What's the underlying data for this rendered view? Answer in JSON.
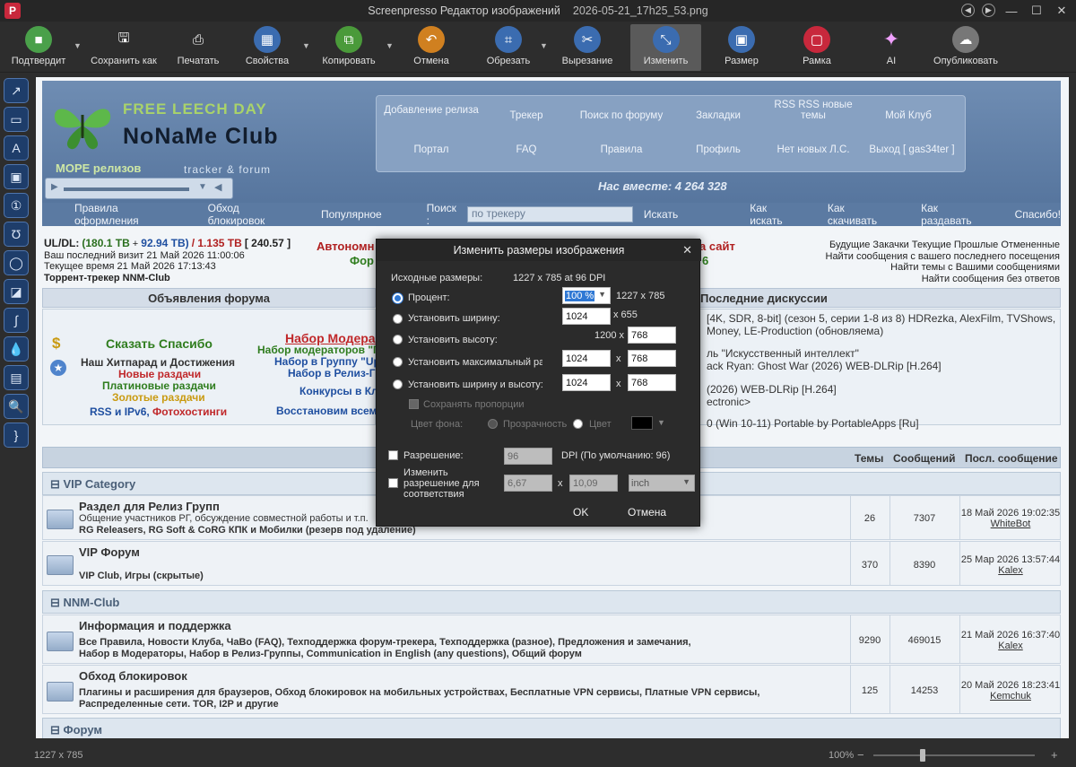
{
  "window": {
    "app_title": "Screenpresso Редактор изображений",
    "file_name": "2026-05-21_17h25_53.png"
  },
  "toolbar": [
    {
      "label": "Подтвердит",
      "icon": "save-check-icon",
      "color": "#4aa04a"
    },
    {
      "label": "Сохранить как",
      "icon": "floppy-icon",
      "color": ""
    },
    {
      "label": "Печатать",
      "icon": "printer-icon",
      "color": ""
    },
    {
      "label": "Свойства",
      "icon": "grid-icon",
      "color": "#3b6cb0"
    },
    {
      "label": "Копировать",
      "icon": "copy-icon",
      "color": "#4a9a3a"
    },
    {
      "label": "Отмена",
      "icon": "undo-icon",
      "color": "#d08020"
    },
    {
      "label": "Обрезать",
      "icon": "crop-icon",
      "color": "#3b6cb0"
    },
    {
      "label": "Вырезание",
      "icon": "cut-icon",
      "color": "#3b6cb0"
    },
    {
      "label": "Изменить",
      "icon": "resize-icon",
      "color": "#3b6cb0"
    },
    {
      "label": "Размер",
      "icon": "size-icon",
      "color": "#3b6cb0"
    },
    {
      "label": "Рамка",
      "icon": "frame-icon",
      "color": "#c8283c"
    },
    {
      "label": "AI",
      "icon": "ai-sparkle-icon",
      "color": ""
    },
    {
      "label": "Опубликовать",
      "icon": "cloud-upload-icon",
      "color": "#777"
    }
  ],
  "site": {
    "logo": {
      "line1": "FREE LEECH DAY",
      "line2": "NoNaMe Club",
      "line3": "МОРЕ релизов",
      "line4": "tracker & forum"
    },
    "nav_top": [
      "Добавление релиза",
      "Трекер",
      "Поиск по форуму",
      "Закладки",
      "RSS RSS новые темы",
      "Мой Клуб"
    ],
    "nav_bottom": [
      "Портал",
      "FAQ",
      "Правила",
      "Профиль",
      "Нет новых Л.С.",
      "Выход [ gas34ter ]"
    ],
    "together": "Нас вместе: 4 264 328",
    "subnav": [
      "Правила оформления",
      "Обход блокировок",
      "Популярное"
    ],
    "search_label": "Поиск :",
    "search_placeholder": "по трекеру",
    "search_button": "Искать",
    "subnav_right": [
      "Как искать",
      "Как скачивать",
      "Как раздавать",
      "Спасибо!"
    ],
    "stats": {
      "ul_dl_label": "UL/DL:",
      "ul": "(180.1 TB",
      "dl": "92.94 TB)",
      "ratio_part": "/ 1.135 TB",
      "bonus": "[ 240.57 ]",
      "last_visit": "Ваш последний визит 21 Май 2026 11:00:06",
      "now": "Текущее время 21 Май 2026 17:13:43",
      "tracker": "Торрент-трекер NNM-Club"
    },
    "promo_left": "Автономн",
    "promo_left2": "Фор",
    "promo_right": "а сайт",
    "promo_right2": "6",
    "right_links": [
      "Будущие Закачки Текущие Прошлые Отмененные",
      "Найти сообщения с вашего последнего посещения",
      "Найти темы с Вашими сообщениями",
      "Найти сообщения без ответов"
    ],
    "forum_ads_title": "Объявления форума",
    "ads_links": [
      "Сказать Спасибо",
      "Наш Хитпарад и Достижения",
      "Новые раздачи",
      "Платиновые раздачи",
      "Золотые раздачи",
      "RSS и IPv6,",
      "Фотохостинги"
    ],
    "moder_links": [
      "Набор Модерат",
      "Набор модераторов \"Г",
      "Набор в Группу \"Up",
      "Набор в Релиз-Гр",
      "Конкурсы в Кл",
      "Восстановим всем"
    ],
    "discussions_title": "Последние дискуссии",
    "discussions": [
      "[4K, SDR, 8-bit] (сезон 5, серии 1-8 из 8) HDRezka, AlexFilm, TVShows,",
      "Money, LE-Production (обновляема)",
      "ль \"Искусственный интеллект\"",
      "ack Ryan: Ghost War (2026) WEB-DLRip [H.264]",
      "(2026) WEB-DLRip [H.264]",
      "ectronic>",
      "0 (Win 10-11) Portable by PortableApps [Ru]"
    ],
    "table_headers": [
      "Темы",
      "Сообщений",
      "Посл. сообщение"
    ],
    "categories": [
      "VIP Category",
      "NNM-Club",
      "Форум"
    ],
    "forums": [
      {
        "title": "Раздел для Релиз Групп",
        "desc": "Общение участников РГ, обсуждение совместной работы и т.п.",
        "subs": "RG Releasers,  RG Soft & CoRG КПК и Мобилки (резерв под удаление)",
        "subs2": "",
        "topics": "26",
        "posts": "7307",
        "last_date": "18 Май 2026 19:02:35",
        "last_user": "WhiteBot"
      },
      {
        "title": "VIP Форум",
        "desc": "",
        "subs": "VIP Club,  Игры (скрытые)",
        "subs2": "",
        "topics": "370",
        "posts": "8390",
        "last_date": "25 Мар 2026 13:57:44",
        "last_user": "Kalex"
      },
      {
        "title": "Информация и поддержка",
        "desc": "",
        "subs": "Все Правила,  Новости Клуба,  ЧаВо (FAQ),  Техподдержка форум-трекера,  Техподдержка (разное),  Предложения и замечания,",
        "subs2": "Набор в Модераторы,  Набор в Релиз-Группы,  Communication in English (any questions),  Общий форум",
        "topics": "9290",
        "posts": "469015",
        "last_date": "21 Май 2026 16:37:40",
        "last_user": "Kalex"
      },
      {
        "title": "Обход блокировок",
        "desc": "",
        "subs": "Плагины и расширения для браузеров,  Обход блокировок на мобильных устройствах,  Бесплатные VPN сервисы,  Платные VPN сервисы,",
        "subs2": "Распределенные сети. TOR, I2P и другие",
        "topics": "125",
        "posts": "14253",
        "last_date": "20 Май 2026 18:23:41",
        "last_user": "Kemchuk"
      }
    ]
  },
  "dialog": {
    "title": "Изменить размеры изображения",
    "original_label": "Исходные размеры:",
    "original_value": "1227 x 785 at 96 DPI",
    "percent_label": "Процент:",
    "percent_value": "100 %",
    "percent_result": "1227 x 785",
    "set_width_label": "Установить ширину:",
    "set_width_value": "1024",
    "set_width_result": "x 655",
    "set_height_label": "Установить высоту:",
    "set_height_result": "1200 x",
    "set_height_value": "768",
    "set_max_label": "Установить максимальный раз",
    "set_max_w": "1024",
    "set_max_h": "768",
    "set_wh_label": "Установить ширину и высоту:",
    "set_wh_w": "1024",
    "set_wh_h": "768",
    "x_sep": "x",
    "keep_prop_label": "Сохранять пропорции",
    "bg_label": "Цвет фона:",
    "transparency_label": "Прозрачность",
    "color_label": "Цвет",
    "resolution_label": "Разрешение:",
    "resolution_value": "96",
    "dpi_label": "DPI (По умолчанию: 96)",
    "change_res_label": "Изменить разрешение для соответствия",
    "fit_w": "6,67",
    "fit_h": "10,09",
    "unit_value": "inch",
    "ok_label": "OK",
    "cancel_label": "Отмена"
  },
  "status": {
    "dims": "1227 x 785",
    "zoom": "100%"
  },
  "colors": {
    "accent": "#2f78d4",
    "link_red": "#c0282a",
    "link_green": "#2f7d1e"
  }
}
